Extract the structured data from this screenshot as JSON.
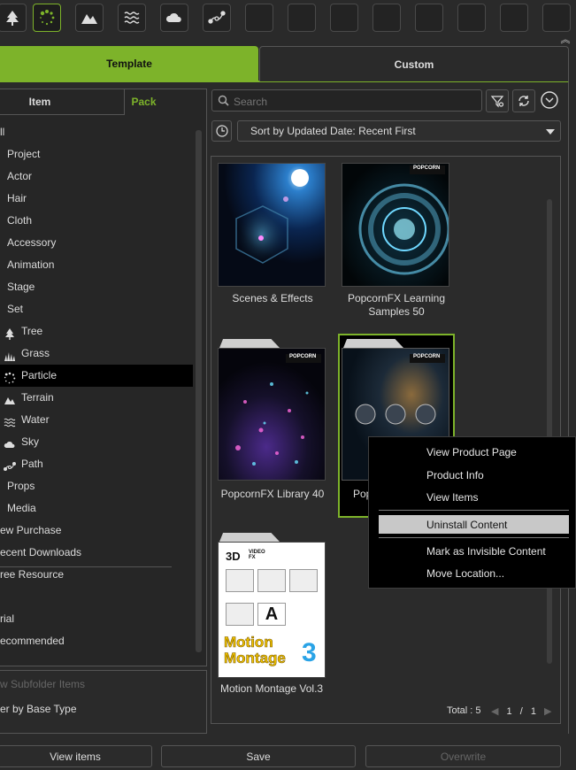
{
  "toolbar": {
    "items": [
      {
        "icon": "tree-icon"
      },
      {
        "icon": "particle-icon",
        "active": true
      },
      {
        "icon": "terrain-icon"
      },
      {
        "icon": "water-icon"
      },
      {
        "icon": "sky-icon"
      },
      {
        "icon": "path-icon"
      },
      {
        "icon": "empty"
      },
      {
        "icon": "empty"
      },
      {
        "icon": "empty"
      },
      {
        "icon": "empty"
      },
      {
        "icon": "empty"
      },
      {
        "icon": "empty"
      },
      {
        "icon": "empty"
      }
    ],
    "collapse_glyph": "︽"
  },
  "tabs": {
    "template": "Template",
    "custom": "Custom"
  },
  "subtabs": {
    "item": "Item",
    "pack": "Pack"
  },
  "tree": [
    {
      "label": "ll"
    },
    {
      "label": "Project"
    },
    {
      "label": "Actor"
    },
    {
      "label": "Hair"
    },
    {
      "label": "Cloth"
    },
    {
      "label": "Accessory"
    },
    {
      "label": "Animation"
    },
    {
      "label": "Stage"
    },
    {
      "label": "Set"
    },
    {
      "label": "Tree",
      "icon": "tree-icon"
    },
    {
      "label": "Grass",
      "icon": "grass-icon"
    },
    {
      "label": "Particle",
      "icon": "particle-icon",
      "selected": true
    },
    {
      "label": "Terrain",
      "icon": "terrain-icon"
    },
    {
      "label": "Water",
      "icon": "water-icon"
    },
    {
      "label": "Sky",
      "icon": "sky-icon"
    },
    {
      "label": "Path",
      "icon": "path-icon"
    },
    {
      "label": "Props"
    },
    {
      "label": "Media"
    },
    {
      "label": "ew Purchase"
    },
    {
      "label": "ecent Downloads"
    },
    {
      "label": "ree Resource"
    },
    {
      "label": ""
    },
    {
      "label": "rial"
    },
    {
      "label": "ecommended"
    }
  ],
  "options": {
    "show_subfolder": "w Subfolder Items",
    "filter_base": "er by Base Type"
  },
  "search": {
    "placeholder": "Search"
  },
  "sort": {
    "label": "Sort by Updated Date: Recent First"
  },
  "packs": [
    {
      "name": "Scenes & Effects"
    },
    {
      "name": "PopcornFX Learning Samples 50"
    },
    {
      "name": "PopcornFX Library 40"
    },
    {
      "name": "Pop",
      "selected": true
    },
    {
      "name": "Motion Montage Vol.3"
    }
  ],
  "thumb_text": {
    "popcorn_logo": "POPCORN",
    "mm_badge": "3D",
    "mm_badge_sub": "VIDEO FX",
    "mm_title": "Motion Montage",
    "mm_num": "3"
  },
  "footer": {
    "total": "Total : 5",
    "page": "1",
    "sep": "/",
    "pages": "1"
  },
  "context_menu": {
    "items": [
      "View Product Page",
      "Product Info",
      "View Items",
      "Uninstall Content",
      "Mark as Invisible Content",
      "Move Location..."
    ],
    "selected": "Uninstall Content"
  },
  "buttons": {
    "view_items": "View items",
    "save": "Save",
    "overwrite": "Overwrite"
  },
  "colors": {
    "accent": "#7db32a",
    "selected_row": "#000000",
    "menu_highlight": "#c8c8c8"
  }
}
